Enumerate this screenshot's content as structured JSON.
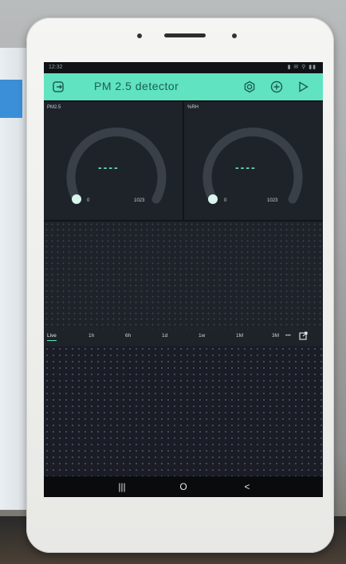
{
  "status_bar": {
    "time": "12:32",
    "icons_text": "▮ ✉ ⚲ ▮▮"
  },
  "header": {
    "title": "PM 2.5  detector"
  },
  "gauges": [
    {
      "label": "PM2.5",
      "value": "----",
      "min": "0",
      "max": "1023",
      "level": 0
    },
    {
      "label": "%RH",
      "value": "----",
      "min": "0",
      "max": "1023",
      "level": 0
    }
  ],
  "time_tabs": {
    "live": "Live",
    "h1": "1h",
    "h6": "6h",
    "d1": "1d",
    "w1": "1w",
    "m1": "1M",
    "m3": "3M",
    "more": "•••"
  },
  "nav": {
    "recent": "|||",
    "home": "O",
    "back": "<"
  },
  "colors": {
    "accent": "#5fe3c0",
    "panel": "#1e2329",
    "background": "#121417"
  }
}
